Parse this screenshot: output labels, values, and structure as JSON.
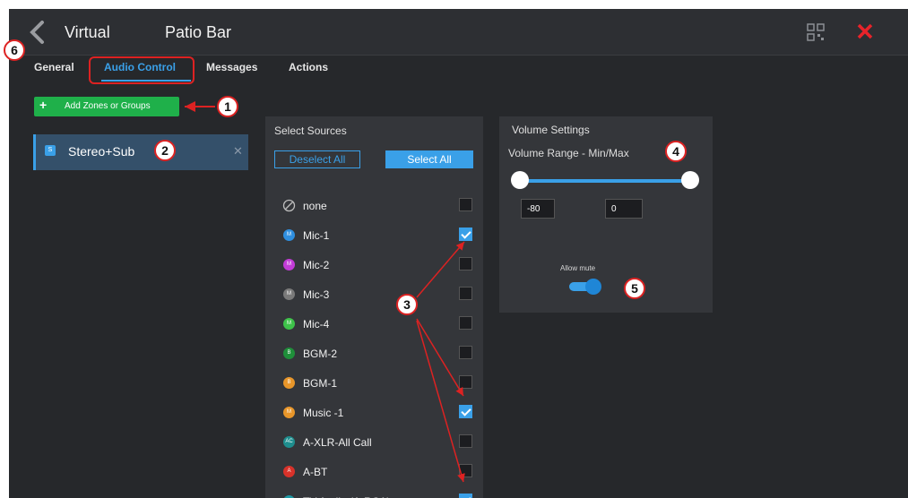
{
  "header": {
    "virtual_label": "Virtual",
    "zone_name": "Patio Bar"
  },
  "tabs": [
    {
      "label": "General",
      "active": false
    },
    {
      "label": "Audio Control",
      "active": true
    },
    {
      "label": "Messages",
      "active": false
    },
    {
      "label": "Actions",
      "active": false
    }
  ],
  "add_button": {
    "label": "Add Zones or Groups"
  },
  "zones": [
    {
      "label": "Stereo+Sub",
      "badge": "S"
    }
  ],
  "sources": {
    "title": "Select Sources",
    "deselect_all": "Deselect All",
    "select_all": "Select All",
    "items": [
      {
        "label": "none",
        "badge": "",
        "color": "",
        "checked": false
      },
      {
        "label": "Mic-1",
        "badge": "M",
        "color": "#2f8fe0",
        "checked": true
      },
      {
        "label": "Mic-2",
        "badge": "M",
        "color": "#c23cd6",
        "checked": false
      },
      {
        "label": "Mic-3",
        "badge": "M",
        "color": "#7a7a7a",
        "checked": false
      },
      {
        "label": "Mic-4",
        "badge": "M",
        "color": "#3ec24a",
        "checked": false
      },
      {
        "label": "BGM-2",
        "badge": "B",
        "color": "#1f8f3a",
        "checked": false
      },
      {
        "label": "BGM-1",
        "badge": "B",
        "color": "#e8962a",
        "checked": false
      },
      {
        "label": "Music -1",
        "badge": "M",
        "color": "#e8962a",
        "checked": true
      },
      {
        "label": "A-XLR-All Call",
        "badge": "AC",
        "color": "#1e8e8e",
        "checked": false
      },
      {
        "label": "A-BT",
        "badge": "A",
        "color": "#d8322a",
        "checked": false
      },
      {
        "label": "TV Audio (A-RCA)",
        "badge": "TA",
        "color": "#1e9aa6",
        "checked": true
      }
    ]
  },
  "volume": {
    "title": "Volume Settings",
    "range_label": "Volume Range - Min/Max",
    "min": "-80",
    "max": "0",
    "allow_mute_label": "Allow mute",
    "allow_mute": true
  },
  "callouts": [
    "1",
    "2",
    "3",
    "4",
    "5",
    "6"
  ],
  "colors": {
    "accent": "#3aa0e8",
    "add_button": "#1fb04a",
    "callout": "#dd2222",
    "close": "#e8232a"
  }
}
